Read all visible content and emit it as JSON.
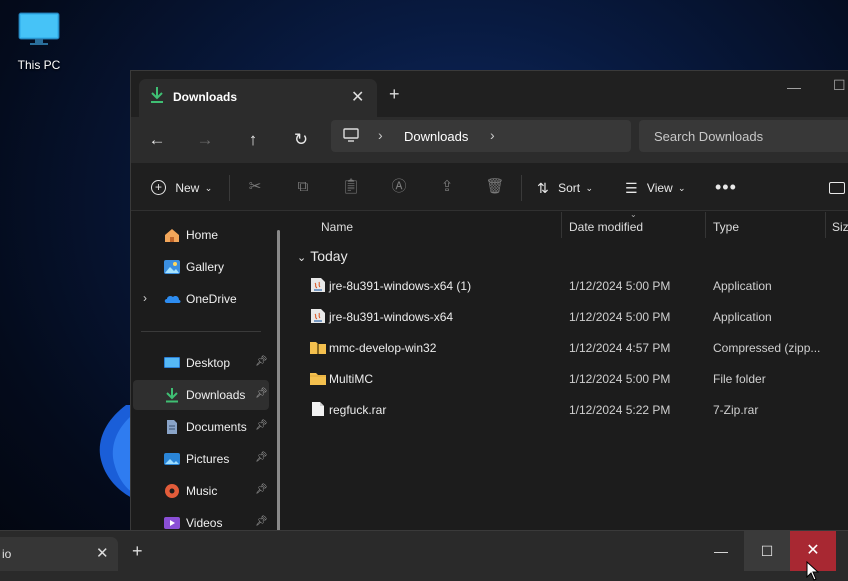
{
  "desktop": {
    "icon_label": "This PC"
  },
  "explorer": {
    "tab_title": "Downloads",
    "breadcrumb": [
      "Downloads"
    ],
    "search_placeholder": "Search Downloads",
    "toolbar": {
      "new_label": "New",
      "sort_label": "Sort",
      "view_label": "View"
    },
    "sidebar": {
      "top_items": [
        {
          "label": "Home",
          "icon": "home-icon"
        },
        {
          "label": "Gallery",
          "icon": "gallery-icon"
        },
        {
          "label": "OneDrive",
          "icon": "onedrive-icon"
        }
      ],
      "pinned_items": [
        {
          "label": "Desktop",
          "icon": "desktop-icon"
        },
        {
          "label": "Downloads",
          "icon": "download-icon",
          "selected": true
        },
        {
          "label": "Documents",
          "icon": "documents-icon"
        },
        {
          "label": "Pictures",
          "icon": "pictures-icon"
        },
        {
          "label": "Music",
          "icon": "music-icon"
        },
        {
          "label": "Videos",
          "icon": "videos-icon"
        }
      ]
    },
    "columns": [
      "Name",
      "Date modified",
      "Type",
      "Size"
    ],
    "group_label": "Today",
    "files": [
      {
        "name": "jre-8u391-windows-x64 (1)",
        "date": "1/12/2024 5:00 PM",
        "type": "Application",
        "icon": "java-installer-icon"
      },
      {
        "name": "jre-8u391-windows-x64",
        "date": "1/12/2024 5:00 PM",
        "type": "Application",
        "icon": "java-installer-icon"
      },
      {
        "name": "mmc-develop-win32",
        "date": "1/12/2024 4:57 PM",
        "type": "Compressed (zipp...",
        "icon": "zip-folder-icon"
      },
      {
        "name": "MultiMC",
        "date": "1/12/2024 5:00 PM",
        "type": "File folder",
        "icon": "folder-icon"
      },
      {
        "name": "regfuck.rar",
        "date": "1/12/2024 5:22 PM",
        "type": "7-Zip.rar",
        "icon": "file-icon"
      }
    ]
  },
  "bottom_window": {
    "tab_title": "io"
  },
  "colors": {
    "accent_green": "#3fbf73",
    "folder_yellow": "#f4c04e",
    "close_red": "#a82832"
  }
}
